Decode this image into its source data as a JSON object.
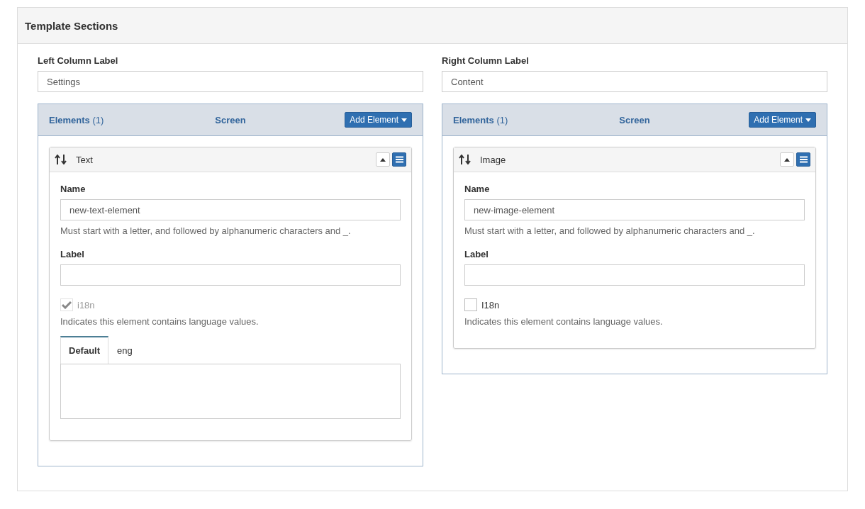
{
  "panel": {
    "title": "Template Sections"
  },
  "columns": [
    {
      "label": "Left Column Label",
      "value": "Settings",
      "elements_title": "Elements",
      "count": "(1)",
      "screen": "Screen",
      "add_button": "Add Element",
      "elements": [
        {
          "type": "Text",
          "name_label": "Name",
          "name_value": "new-text-element",
          "name_help": "Must start with a letter, and followed by alphanumeric characters and _.",
          "label_label": "Label",
          "i18n": {
            "label": "i18n",
            "checked": true,
            "disabled": true
          },
          "i18n_help": "Indicates this element contains language values.",
          "lang_tabs": [
            {
              "label": "Default",
              "selected": true
            },
            {
              "label": "eng",
              "selected": false
            }
          ]
        }
      ]
    },
    {
      "label": "Right Column Label",
      "value": "Content",
      "elements_title": "Elements",
      "count": "(1)",
      "screen": "Screen",
      "add_button": "Add Element",
      "elements": [
        {
          "type": "Image",
          "name_label": "Name",
          "name_value": "new-image-element",
          "name_help": "Must start with a letter, and followed by alphanumeric characters and _.",
          "label_label": "Label",
          "i18n": {
            "label": "I18n",
            "checked": false,
            "disabled": false
          },
          "i18n_help": "Indicates this element contains language values."
        }
      ]
    }
  ]
}
